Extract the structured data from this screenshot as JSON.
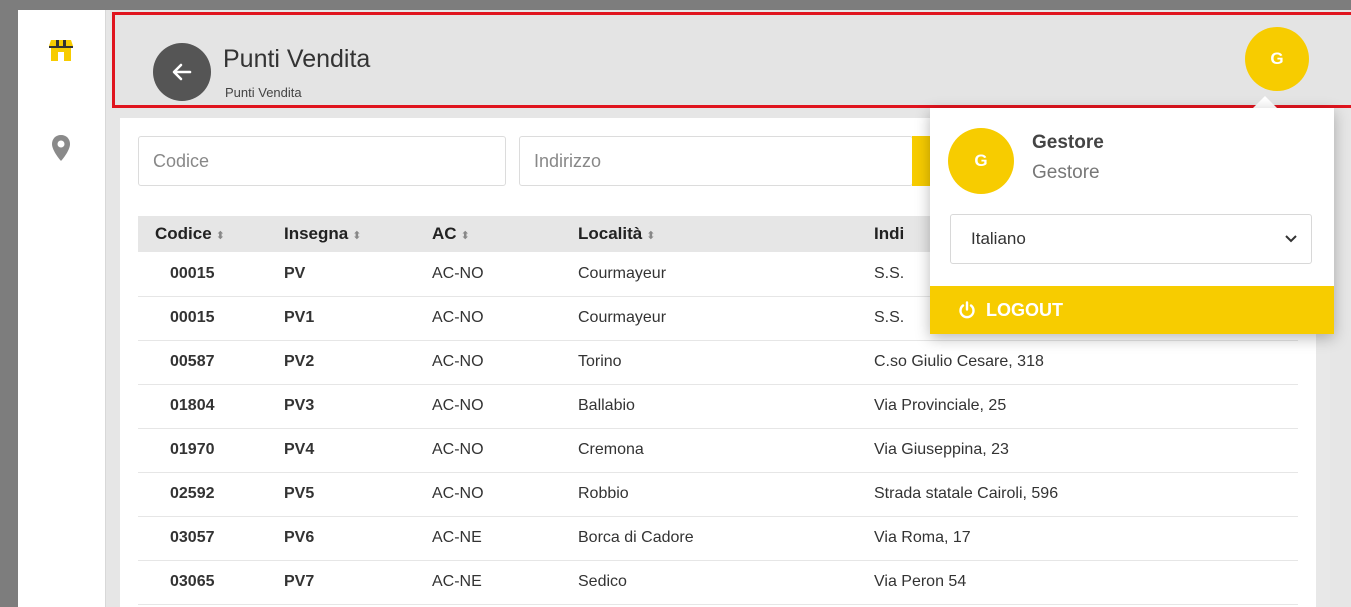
{
  "colors": {
    "accent": "#f7cc00",
    "highlight_border": "#e0141e",
    "back_button": "#555555"
  },
  "sidebar": {
    "items": [
      {
        "icon": "store-icon"
      },
      {
        "icon": "map-pin-icon"
      }
    ]
  },
  "header": {
    "title": "Punti Vendita",
    "subtitle": "Punti Vendita",
    "avatar_initial": "G"
  },
  "filters": {
    "codice_placeholder": "Codice",
    "indirizzo_placeholder": "Indirizzo"
  },
  "table": {
    "columns": [
      "Codice",
      "Insegna",
      "AC",
      "Località",
      "Indirizzo"
    ],
    "header_indirizzo_visible": "Indi",
    "rows": [
      {
        "codice": "00015",
        "insegna": "PV",
        "ac": "AC-NO",
        "localita": "Courmayeur",
        "indirizzo": "S.S. "
      },
      {
        "codice": "00015",
        "insegna": "PV1",
        "ac": "AC-NO",
        "localita": "Courmayeur",
        "indirizzo": "S.S. "
      },
      {
        "codice": "00587",
        "insegna": "PV2",
        "ac": "AC-NO",
        "localita": "Torino",
        "indirizzo": "C.so Giulio Cesare, 318"
      },
      {
        "codice": "01804",
        "insegna": "PV3",
        "ac": "AC-NO",
        "localita": "Ballabio",
        "indirizzo": "Via Provinciale, 25"
      },
      {
        "codice": "01970",
        "insegna": "PV4",
        "ac": "AC-NO",
        "localita": "Cremona",
        "indirizzo": "Via Giuseppina, 23"
      },
      {
        "codice": "02592",
        "insegna": "PV5",
        "ac": "AC-NO",
        "localita": "Robbio",
        "indirizzo": "Strada statale Cairoli, 596"
      },
      {
        "codice": "03057",
        "insegna": "PV6",
        "ac": "AC-NE",
        "localita": "Borca di Cadore",
        "indirizzo": "Via Roma, 17"
      },
      {
        "codice": "03065",
        "insegna": "PV7",
        "ac": "AC-NE",
        "localita": "Sedico",
        "indirizzo": "Via Peron 54"
      }
    ]
  },
  "user_menu": {
    "avatar_initial": "G",
    "name": "Gestore",
    "role": "Gestore",
    "language": "Italiano",
    "logout_label": "LOGOUT"
  }
}
